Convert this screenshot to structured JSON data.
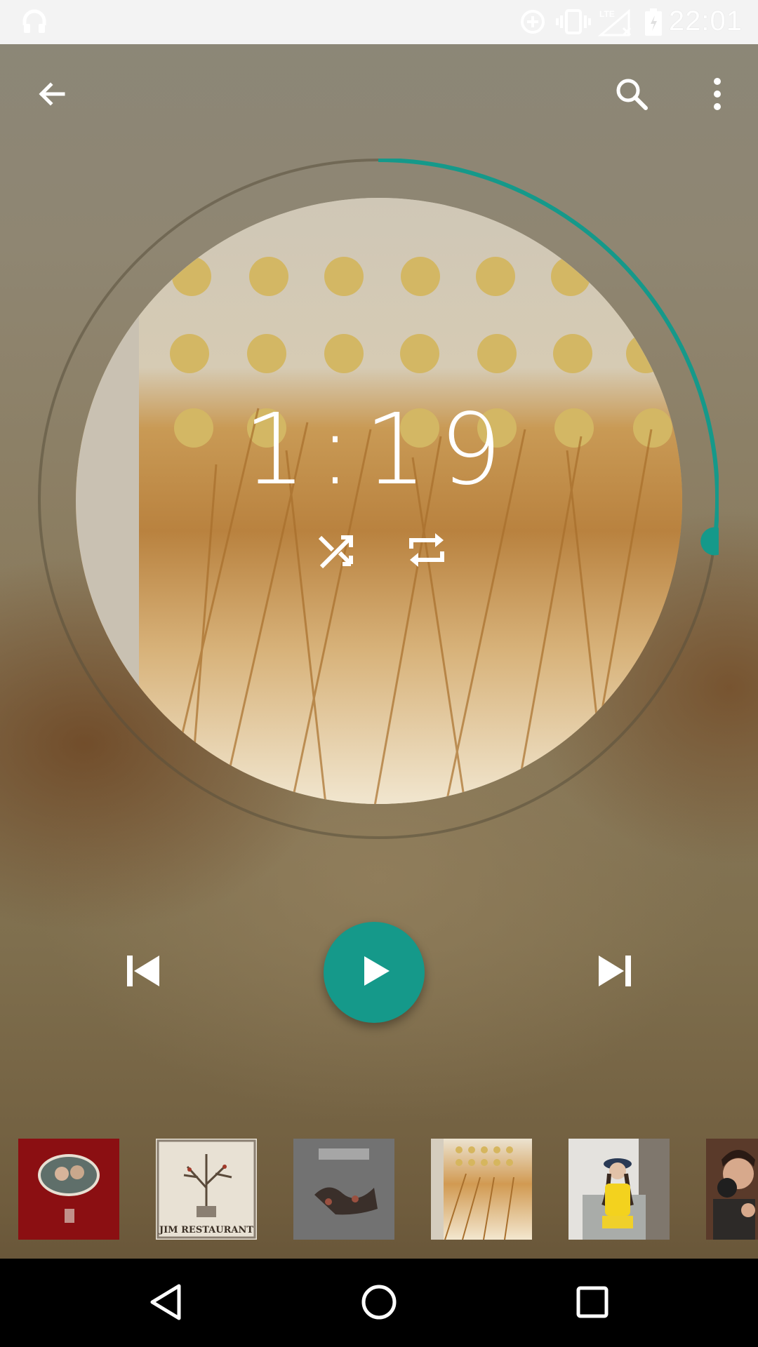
{
  "status_bar": {
    "time": "22:01",
    "icons": [
      "headset-icon",
      "data-saver-icon",
      "vibrate-icon",
      "lte-signal-icon",
      "battery-icon"
    ]
  },
  "toolbar": {
    "back_icon": "arrow-back-icon",
    "search_icon": "search-icon",
    "more_icon": "more-vert-icon"
  },
  "player": {
    "elapsed_time": "1:19",
    "progress_fraction": 0.27,
    "shuffle_icon": "shuffle-icon",
    "repeat_icon": "repeat-icon",
    "prev_icon": "skip-previous-icon",
    "play_icon": "play-icon",
    "next_icon": "skip-next-icon",
    "accent_color": "#15998a"
  },
  "album_strip": {
    "items": [
      {
        "name": "album-thumb-1",
        "lettering": "",
        "color": "#8b0f12"
      },
      {
        "name": "album-thumb-2",
        "lettering": "JIM RESTAURANT",
        "color": "#e8e1d4"
      },
      {
        "name": "album-thumb-3",
        "lettering": "",
        "color": "#6a6a6a"
      },
      {
        "name": "album-thumb-4",
        "lettering": "",
        "color": "#e7c98f"
      },
      {
        "name": "album-thumb-5",
        "lettering": "",
        "color": "#d9d6d0"
      },
      {
        "name": "album-thumb-6",
        "lettering": "",
        "color": "#5a3a2a"
      }
    ]
  },
  "nav_bar": {
    "back": "nav-back-icon",
    "home": "nav-home-icon",
    "recents": "nav-recents-icon"
  }
}
